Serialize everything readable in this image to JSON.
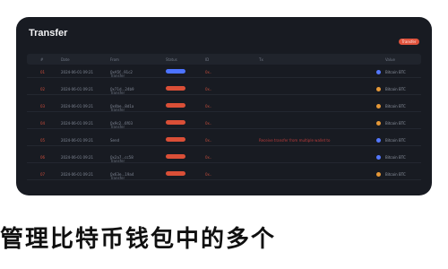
{
  "window": {
    "title": "Transfer",
    "top_button": "Transfer"
  },
  "table": {
    "headers": [
      "#",
      "Date",
      "From",
      "Status",
      "ID",
      "Tx",
      "Value"
    ],
    "rows": [
      {
        "rank": "01",
        "date": "2024-06-01 09:21",
        "a1": "0xA5f...91c2",
        "a2": "Transfer",
        "chip": "blue",
        "id": "0x..",
        "long": "",
        "right": "Bitcoin BTC",
        "dot": "blue"
      },
      {
        "rank": "02",
        "date": "2024-06-01 09:21",
        "a1": "0x71d...24b9",
        "a2": "Transfer",
        "chip": "red",
        "id": "0x..",
        "long": "",
        "right": "Bitcoin BTC",
        "dot": "orange"
      },
      {
        "rank": "03",
        "date": "2024-06-01 09:21",
        "a1": "0x4be...8d1a",
        "a2": "Transfer",
        "chip": "red",
        "id": "0x..",
        "long": "",
        "right": "Bitcoin BTC",
        "dot": "orange"
      },
      {
        "rank": "04",
        "date": "2024-06-01 09:21",
        "a1": "0x9c2...6f03",
        "a2": "Transfer",
        "chip": "red",
        "id": "0x..",
        "long": "",
        "right": "Bitcoin BTC",
        "dot": "orange"
      },
      {
        "rank": "05",
        "date": "2024-06-01 09:21",
        "a1": "Send",
        "a2": "",
        "chip": "red",
        "id": "0x..",
        "long": "Receive transfer from multiple wallet to",
        "right": "Bitcoin BTC",
        "dot": "blue"
      },
      {
        "rank": "06",
        "date": "2024-06-01 09:21",
        "a1": "0x2a7...cc58",
        "a2": "Transfer",
        "chip": "red",
        "id": "0x..",
        "long": "",
        "right": "Bitcoin BTC",
        "dot": "blue"
      },
      {
        "rank": "07",
        "date": "2024-06-01 09:21",
        "a1": "0x63e...19a4",
        "a2": "Transfer",
        "chip": "red",
        "id": "0x..",
        "long": "",
        "right": "Bitcoin BTC",
        "dot": "orange"
      }
    ]
  },
  "bottom_banner": "管理比特币钱包中的多个"
}
